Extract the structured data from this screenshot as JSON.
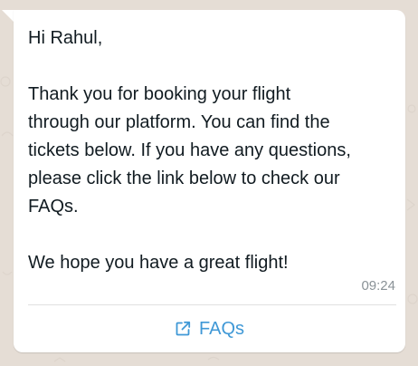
{
  "message": {
    "text": "Hi Rahul,\n\nThank you for booking your flight\nthrough our platform. You can find the\ntickets below. If you have any questions,\nplease click the link below to check our\nFAQs.\n\nWe hope you have a great flight!",
    "timestamp": "09:24"
  },
  "button": {
    "label": "FAQs",
    "icon": "external-link-icon"
  },
  "colors": {
    "chat_background": "#e5ddd5",
    "bubble": "#ffffff",
    "link": "#3f98d6",
    "timestamp": "#8a9297"
  }
}
